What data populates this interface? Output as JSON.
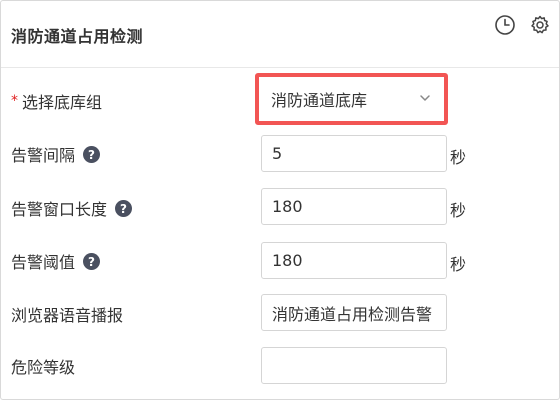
{
  "panel": {
    "title": "消防通道占用检测",
    "icons": {
      "history": "clock-icon",
      "settings": "gear-icon"
    }
  },
  "fields": {
    "library_group": {
      "label": "选择底库组",
      "required_mark": "*",
      "value": "消防通道底库"
    },
    "alert_interval": {
      "label": "告警间隔",
      "value": "5",
      "unit": "秒"
    },
    "alert_window": {
      "label": "告警窗口长度",
      "value": "180",
      "unit": "秒"
    },
    "alert_threshold": {
      "label": "告警阈值",
      "value": "180",
      "unit": "秒"
    },
    "voice_broadcast": {
      "label": "浏览器语音播报",
      "value": "消防通道占用检测告警"
    },
    "danger_level": {
      "label": "危险等级",
      "value": ""
    }
  },
  "colors": {
    "highlight": "#f25554",
    "required": "#e02020",
    "help_icon": "#4a5060"
  }
}
